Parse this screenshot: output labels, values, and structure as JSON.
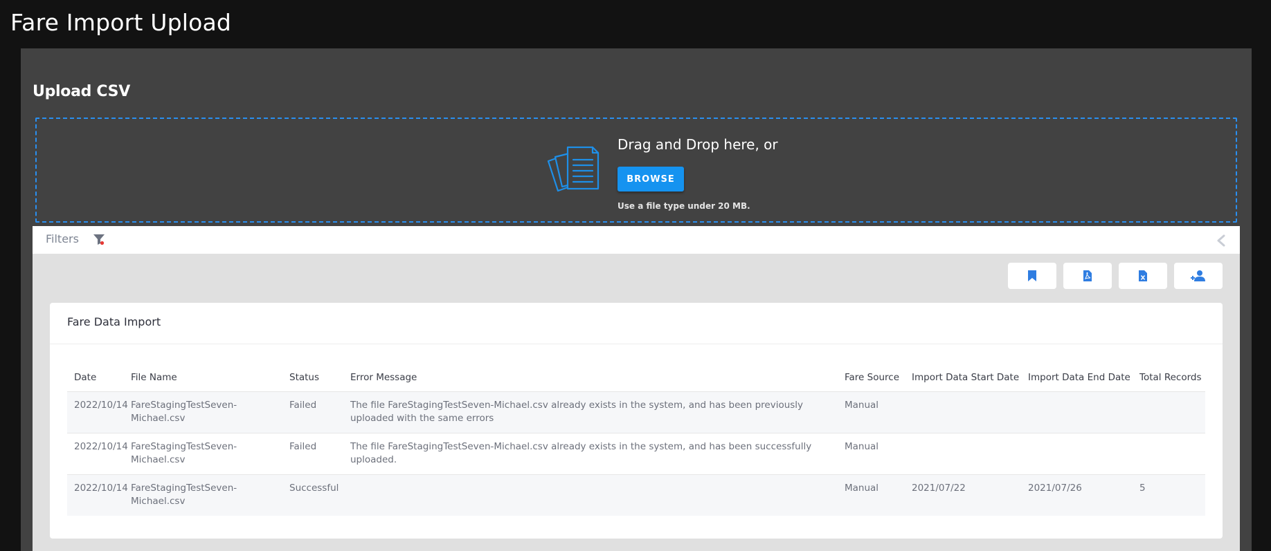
{
  "page": {
    "title": "Fare Import Upload"
  },
  "upload": {
    "title": "Upload CSV",
    "drop_text": "Drag and Drop here, or",
    "browse_label": "BROWSE",
    "hint": "Use a file type under 20 MB.",
    "icon": "documents-icon"
  },
  "filters": {
    "label": "Filters",
    "icon": "filter-icon",
    "collapse_icon": "chevron-left-icon"
  },
  "actions": [
    {
      "name": "bookmark-button",
      "icon": "bookmark-icon"
    },
    {
      "name": "export-pdf-button",
      "icon": "pdf-file-icon"
    },
    {
      "name": "export-excel-button",
      "icon": "excel-file-icon"
    },
    {
      "name": "add-user-button",
      "icon": "add-user-icon"
    }
  ],
  "table": {
    "title": "Fare Data Import",
    "columns": [
      "Date",
      "File Name",
      "Status",
      "Error Message",
      "Fare Source",
      "Import Data Start Date",
      "Import Data End Date",
      "Total Records"
    ],
    "rows": [
      {
        "date": "2022/10/14",
        "file_name": "FareStagingTestSeven-Michael.csv",
        "status": "Failed",
        "error_message": "The file FareStagingTestSeven-Michael.csv already exists in the system, and has been previously uploaded with the same errors",
        "fare_source": "Manual",
        "start_date": "",
        "end_date": "",
        "total_records": ""
      },
      {
        "date": "2022/10/14",
        "file_name": "FareStagingTestSeven-Michael.csv",
        "status": "Failed",
        "error_message": "The file FareStagingTestSeven-Michael.csv already exists in the system, and has been successfully uploaded.",
        "fare_source": "Manual",
        "start_date": "",
        "end_date": "",
        "total_records": ""
      },
      {
        "date": "2022/10/14",
        "file_name": "FareStagingTestSeven-Michael.csv",
        "status": "Successful",
        "error_message": "",
        "fare_source": "Manual",
        "start_date": "2021/07/22",
        "end_date": "2021/07/26",
        "total_records": "5"
      }
    ]
  },
  "colors": {
    "background": "#121212",
    "panel": "#424242",
    "accent": "#1593f0",
    "dropzone_border": "#2a8ff0",
    "icon_blue": "#2f7de1",
    "filter_dot": "#e53935"
  }
}
